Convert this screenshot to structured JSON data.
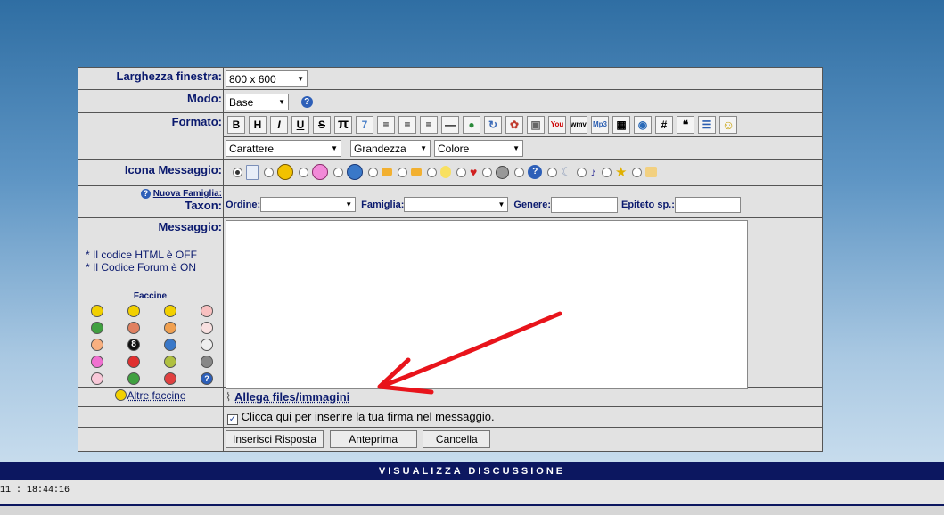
{
  "labels": {
    "width": "Larghezza finestra:",
    "mode": "Modo:",
    "format": "Formato:",
    "icon_message": "Icona Messaggio:",
    "new_family": "Nuova Famiglia:",
    "taxon": "Taxon:",
    "message": "Messaggio:",
    "html_off": "* Il codice HTML è OFF",
    "forum_on": "* Il Codice Forum è ON",
    "faccine": "Faccine",
    "altre_faccine": "Altre faccine"
  },
  "selects": {
    "width": "800 x 600",
    "mode": "Base",
    "carattere": "Carattere",
    "grandezza": "Grandezza",
    "colore": "Colore"
  },
  "taxon_fields": {
    "ordine": "Ordine:",
    "famiglia": "Famiglia:",
    "genere": "Genere:",
    "epiteto": "Epiteto sp.:"
  },
  "toolbar": [
    "B",
    "H",
    "I",
    "U",
    "S",
    "π",
    "7",
    "≡",
    "≡",
    "≡",
    "—",
    "●",
    "↻",
    "✿",
    "▣",
    "You",
    "wmv",
    "Mp3",
    "▦",
    "◉",
    "#",
    "❝",
    "☰",
    "☺"
  ],
  "attach_label": "Allega files/immagini",
  "signature_label": "Clicca qui per inserire la tua firma nel messaggio.",
  "buttons": {
    "submit": "Inserisci Risposta",
    "preview": "Anteprima",
    "cancel": "Cancella"
  },
  "footer": {
    "title": "VISUALIZZA DISCUSSIONE",
    "time": "11 : 18:44:16"
  },
  "colors": {
    "label_text": "#0b1a6e",
    "arrow": "#e8141b",
    "bar": "#0c1760"
  }
}
